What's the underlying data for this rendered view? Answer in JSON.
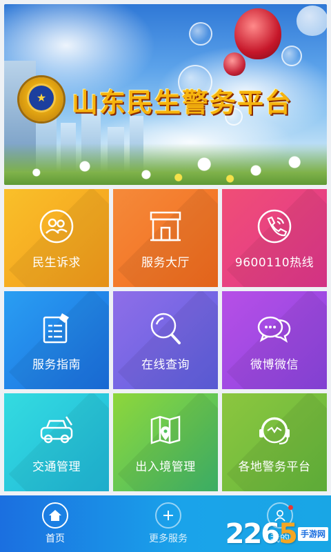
{
  "banner": {
    "title": "山东民生警务平台"
  },
  "tiles": [
    {
      "label": "民生诉求",
      "icon": "people-icon",
      "color_from": "#f9c02a",
      "color_to": "#f49a1a"
    },
    {
      "label": "服务大厅",
      "icon": "service-hall-icon",
      "color_from": "#f58a3a",
      "color_to": "#f26a1c"
    },
    {
      "label": "9600110热线",
      "icon": "phone-icon",
      "color_from": "#f04e76",
      "color_to": "#e0368d"
    },
    {
      "label": "服务指南",
      "icon": "guide-icon",
      "color_from": "#2a9ef2",
      "color_to": "#1a6fe0"
    },
    {
      "label": "在线查询",
      "icon": "search-icon",
      "color_from": "#8f6ee8",
      "color_to": "#5d5fe0"
    },
    {
      "label": "微博微信",
      "icon": "chat-icon",
      "color_from": "#b74fe6",
      "color_to": "#8a45e0"
    },
    {
      "label": "交通管理",
      "icon": "car-icon",
      "color_from": "#34dbe0",
      "color_to": "#1fb7d8"
    },
    {
      "label": "出入境管理",
      "icon": "map-icon",
      "color_from": "#8ed63b",
      "color_to": "#3fb86b"
    },
    {
      "label": "各地警务平台",
      "icon": "headset-icon",
      "color_from": "#8cc63f",
      "color_to": "#63b63c"
    }
  ],
  "nav": {
    "home": "首页",
    "more": "更多服务",
    "mine": "我的"
  },
  "watermark": {
    "number_main": "226",
    "number_tail": "5",
    "site": "手游网"
  }
}
